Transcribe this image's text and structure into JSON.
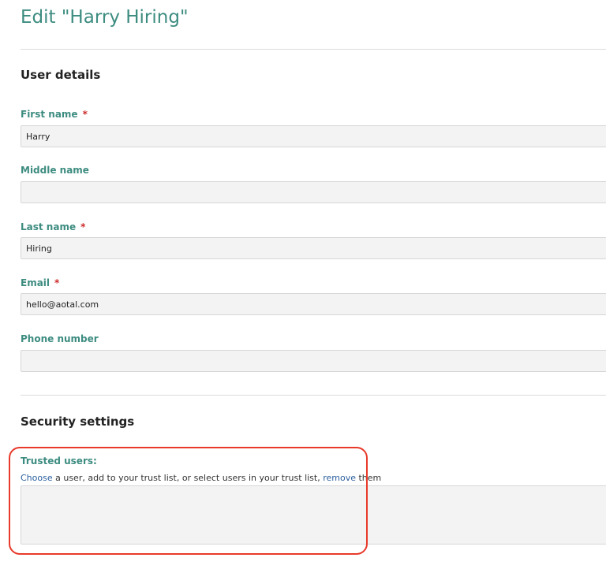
{
  "page": {
    "title": "Edit \"Harry Hiring\""
  },
  "user_details": {
    "heading": "User details",
    "required_marker": "*",
    "fields": {
      "first_name": {
        "label": "First name",
        "value": "Harry"
      },
      "middle_name": {
        "label": "Middle name",
        "value": ""
      },
      "last_name": {
        "label": "Last name",
        "value": "Hiring"
      },
      "email": {
        "label": "Email",
        "value": "hello@aotal.com"
      },
      "phone": {
        "label": "Phone number",
        "value": ""
      }
    }
  },
  "security": {
    "heading": "Security settings",
    "trusted_users": {
      "label": "Trusted users:",
      "help": {
        "choose_link": "Choose",
        "middle_text": " a user, add to your trust list, or select users in your trust list, ",
        "remove_link": "remove",
        "end_text": " them"
      }
    }
  },
  "colors": {
    "accent": "#3d8c80",
    "required": "#cc2b2b",
    "link": "#2a5f9e",
    "annotation": "#e8392a"
  }
}
